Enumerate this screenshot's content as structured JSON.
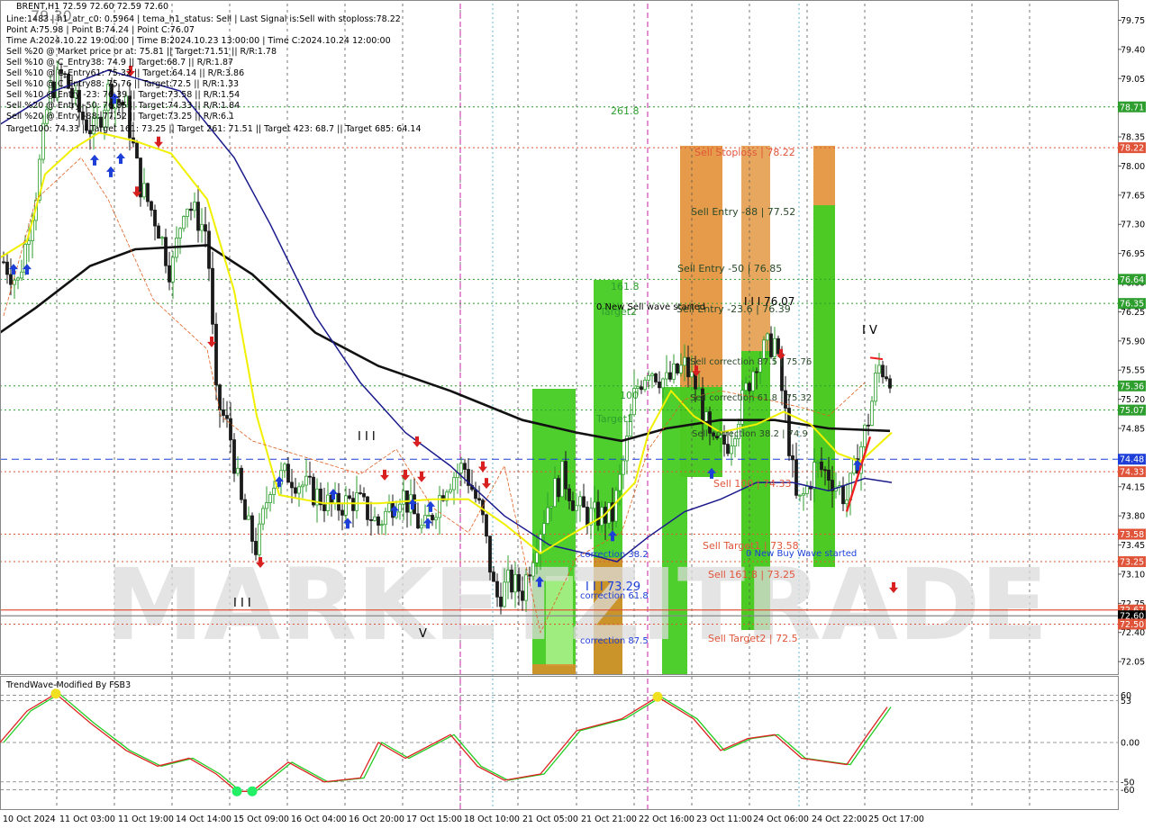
{
  "header": {
    "symbol": "BRENT,H1  72.59 72.60 72.59 72.60",
    "lines": [
      "Line:1483 | h1_atr_c0: 0.5964 | tema_h1_status: Sell | Last Signal is:Sell with stoploss:78.22",
      "Point A:75.98 | Point B:74.24 | Point C:76.07",
      "Time A:2024.10.22 19:00:00 | Time B:2024.10.23 13:00:00 | Time C:2024.10.24 12:00:00",
      "Sell %20 @ Market price or at: 75.81 || Target:71.51 || R/R:1.78",
      "Sell %10 @ C_Entry38: 74.9 || Target:68.7 || R/R:1.87",
      "Sell %10 @ C_Entry61: 75.32 || Target:64.14 || R/R:3.86",
      "Sell %10 @ C_Entry88: 75.76 || Target:72.5 || R/R:1.33",
      "Sell %10 @ Entry -23: 76.39 || Target:73.58 || R/R:1.54",
      "Sell %20 @ Entry -50: 76.85 || Target:74.33 || R/R:1.84",
      "Sell %20 @ Entry -88: 77.52 || Target:73.25 || R/R:6.1",
      "Target100: 74.33 || Target 161: 73.25 || Target 261: 71.51 || Target 423: 68.7 || Target 685: 64.14"
    ],
    "overlay_number": "79.30"
  },
  "chart_data": {
    "type": "candlestick",
    "symbol": "BRENT",
    "timeframe": "H1",
    "price_axis": {
      "ylim": [
        71.9,
        79.95
      ],
      "ticks": [
        "79.75",
        "79.40",
        "79.05",
        "78.70",
        "78.35",
        "78.00",
        "77.65",
        "77.30",
        "76.95",
        "76.60",
        "76.25",
        "75.90",
        "75.55",
        "75.20",
        "74.85",
        "74.50",
        "74.15",
        "73.80",
        "73.45",
        "73.10",
        "72.75",
        "72.40",
        "72.05"
      ]
    },
    "time_axis": {
      "labels": [
        "10 Oct 2024",
        "11 Oct 03:00",
        "11 Oct 19:00",
        "14 Oct 14:00",
        "15 Oct 09:00",
        "16 Oct 04:00",
        "16 Oct 20:00",
        "17 Oct 15:00",
        "18 Oct 10:00",
        "21 Oct 05:00",
        "21 Oct 21:00",
        "22 Oct 16:00",
        "23 Oct 11:00",
        "24 Oct 06:00",
        "24 Oct 22:00",
        "25 Oct 17:00"
      ]
    },
    "price_tags": [
      {
        "value": 78.71,
        "text": "78.71",
        "color": "#2e9e2e"
      },
      {
        "value": 78.22,
        "text": "78.22",
        "color": "#e0553a"
      },
      {
        "value": 76.64,
        "text": "76.64",
        "color": "#2e9e2e"
      },
      {
        "value": 76.35,
        "text": "76.35",
        "color": "#2e9e2e"
      },
      {
        "value": 75.36,
        "text": "75.36",
        "color": "#2e9e2e"
      },
      {
        "value": 75.07,
        "text": "75.07",
        "color": "#2e9e2e"
      },
      {
        "value": 74.48,
        "text": "74.48",
        "color": "#1d3fd8"
      },
      {
        "value": 74.33,
        "text": "74.33",
        "color": "#e0553a"
      },
      {
        "value": 73.58,
        "text": "73.58",
        "color": "#e0553a"
      },
      {
        "value": 73.25,
        "text": "73.25",
        "color": "#e0553a"
      },
      {
        "value": 72.67,
        "text": "72.67",
        "color": "#e0553a"
      },
      {
        "value": 72.6,
        "text": "72.60",
        "color": "#000000"
      },
      {
        "value": 72.5,
        "text": "72.50",
        "color": "#e0553a"
      }
    ],
    "levels": [
      {
        "value": 78.71,
        "color": "#2e9e2e",
        "style": "dotted"
      },
      {
        "value": 78.22,
        "color": "#e0553a",
        "style": "dotted"
      },
      {
        "value": 76.64,
        "color": "#2e9e2e",
        "style": "dotted"
      },
      {
        "value": 76.35,
        "color": "#2e9e2e",
        "style": "dotted"
      },
      {
        "value": 75.36,
        "color": "#2e9e2e",
        "style": "dotted"
      },
      {
        "value": 75.07,
        "color": "#2e9e2e",
        "style": "dotted"
      },
      {
        "value": 74.48,
        "color": "#1d3fd8",
        "style": "dashed"
      },
      {
        "value": 74.33,
        "color": "#e0553a",
        "style": "dotted"
      },
      {
        "value": 73.58,
        "color": "#e0553a",
        "style": "dotted"
      },
      {
        "value": 73.25,
        "color": "#e0553a",
        "style": "dotted"
      },
      {
        "value": 72.67,
        "color": "#e0553a",
        "style": "solid"
      },
      {
        "value": 72.6,
        "color": "#888888",
        "style": "solid"
      },
      {
        "value": 72.5,
        "color": "#e0553a",
        "style": "dotted"
      }
    ],
    "annotations": [
      {
        "text": "261.8",
        "color": "#2e9e2e"
      },
      {
        "text": "161.8",
        "color": "#2e9e2e"
      },
      {
        "text": "100",
        "color": "#2e9e2e"
      },
      {
        "text": "Target1",
        "color": "#2e9e2e"
      },
      {
        "text": "Target2",
        "color": "#2e9e2e"
      },
      {
        "text": "0 New Sell wave started",
        "color": "#000000"
      },
      {
        "text": "Sell Stoploss | 78.22",
        "color": "#e0553a"
      },
      {
        "text": "Sell Entry -88 | 77.52",
        "color": "#2a4a2a"
      },
      {
        "text": "Sell Entry -50 | 76.85",
        "color": "#2a4a2a"
      },
      {
        "text": "Sell Entry -23.6 | 76.39",
        "color": "#2a4a2a"
      },
      {
        "text": "I I I 76.07",
        "color": "#000000"
      },
      {
        "text": "Sell correction 87.5 | 75.76",
        "color": "#2a4a2a"
      },
      {
        "text": "Sell correction 61.8 | 75.32",
        "color": "#2a4a2a"
      },
      {
        "text": "Sell correction 38.2 | 74.9",
        "color": "#2a4a2a"
      },
      {
        "text": "Sell 100 | 74.33",
        "color": "#e0553a"
      },
      {
        "text": "Sell Target1 | 73.58",
        "color": "#e0553a"
      },
      {
        "text": "Sell 161.8 | 73.25",
        "color": "#e0553a"
      },
      {
        "text": "Sell Target2 | 72.5",
        "color": "#e0553a"
      },
      {
        "text": "0 New Buy Wave started",
        "color": "#1d3fd8"
      },
      {
        "text": "correction 38.2",
        "color": "#1d3fd8"
      },
      {
        "text": "correction 61.8",
        "color": "#1d3fd8"
      },
      {
        "text": "correction 87.5",
        "color": "#1d3fd8"
      },
      {
        "text": "I I I 73.29",
        "color": "#1d3fd8"
      },
      {
        "text": "I V",
        "color": "#000000"
      },
      {
        "text": "I I I",
        "color": "#000000"
      },
      {
        "text": "V",
        "color": "#000000"
      },
      {
        "text": "I I I",
        "color": "#000000"
      }
    ],
    "indicator": {
      "title": "TrendWave-Modified By FSB3",
      "ticks": [
        "60",
        "53",
        "0.00",
        "-50",
        "-60"
      ],
      "ylim": [
        -80,
        80
      ]
    },
    "watermark": "MARKETZITRADE",
    "colors": {
      "bull_candle": "#2e9e2e",
      "bear_candle": "#1a1a1a",
      "ma_long": "#111111",
      "ma_navy": "#1a1a8c",
      "ma_yellow": "#f0f000",
      "zone_green": "#44cc22",
      "zone_orange": "#e08a2a",
      "buy_arrow": "#1d3fd8",
      "sell_arrow": "#d82020"
    }
  }
}
